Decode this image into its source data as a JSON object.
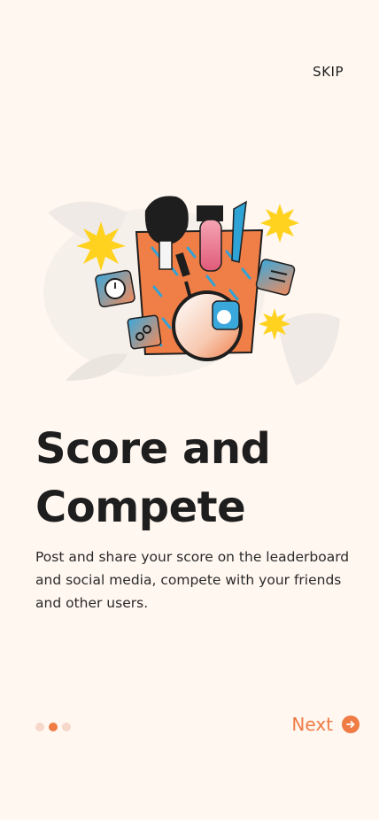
{
  "header": {
    "skip_label": "SKIP"
  },
  "onboarding": {
    "title_line1": "Score and",
    "title_line2": "Compete",
    "description": "Post and share your score on the leaderboard and social media, compete with your friends and other users."
  },
  "pager": {
    "total_pages": 3,
    "active_page": 2
  },
  "footer": {
    "next_label": "Next",
    "next_icon": "arrow-right-circle-icon"
  },
  "colors": {
    "background": "#FFF7F0",
    "accent": "#EF7B45",
    "dot_inactive": "#F6D8CA",
    "text_primary": "#1E1E1E"
  },
  "illustration": {
    "icon": "makeup-bag-with-magnifier-icon"
  }
}
